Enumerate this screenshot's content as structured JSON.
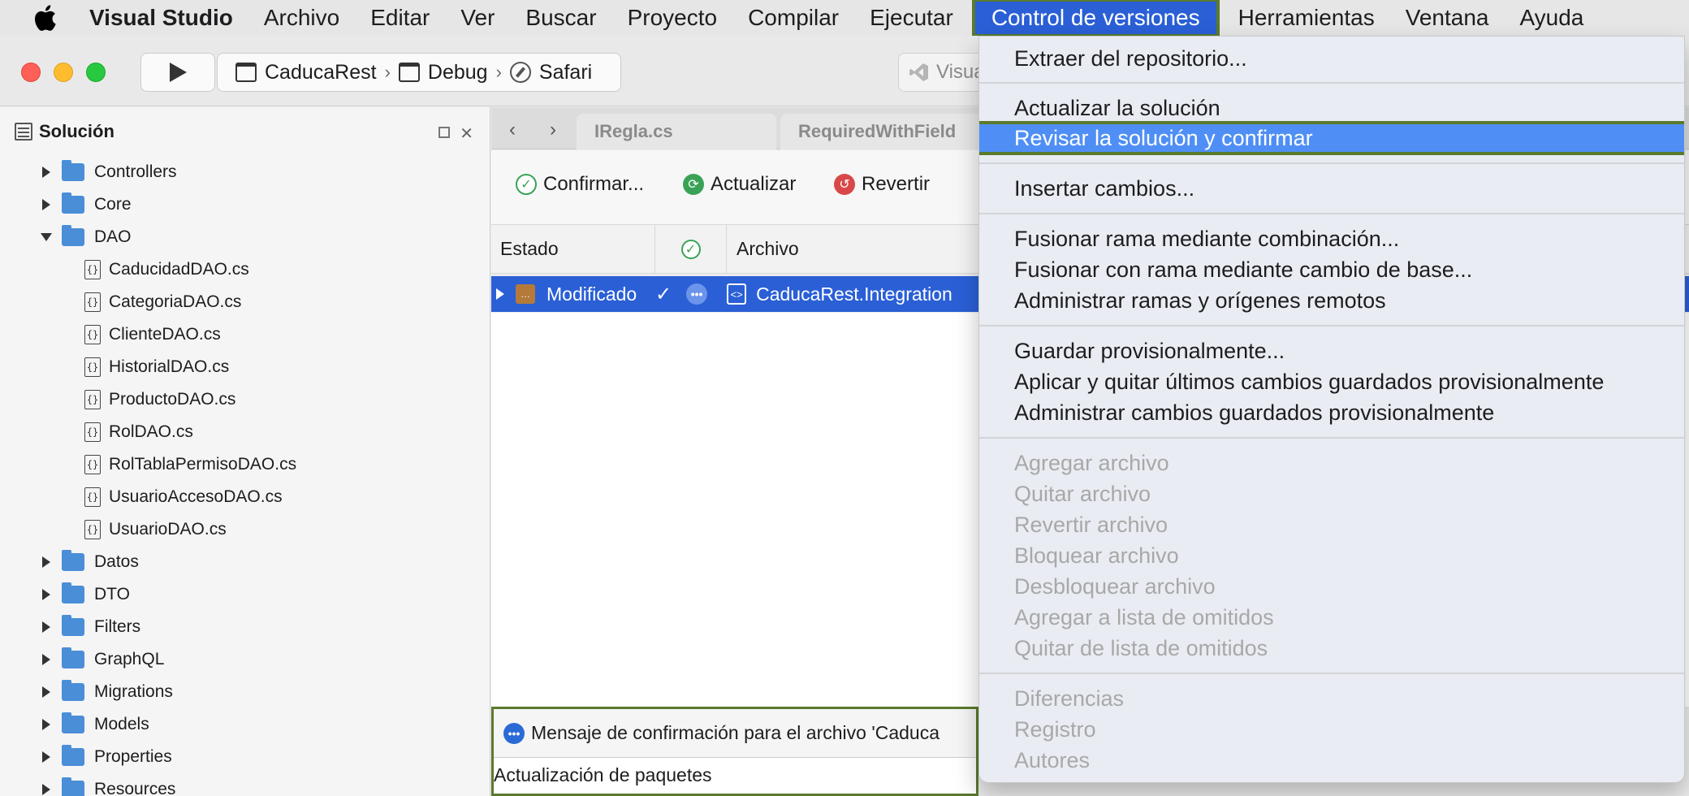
{
  "menubar": {
    "app_name": "Visual Studio",
    "menus": [
      "Archivo",
      "Editar",
      "Ver",
      "Buscar",
      "Proyecto",
      "Compilar",
      "Ejecutar",
      "Control de versiones",
      "Herramientas",
      "Ventana",
      "Ayuda"
    ],
    "active_menu": "Control de versiones"
  },
  "toolbar": {
    "project": "CaducaRest",
    "configuration": "Debug",
    "target": "Safari",
    "vs_badge": "Visua"
  },
  "solution_pad": {
    "title": "Solución",
    "items": [
      {
        "label": "Controllers",
        "type": "folder",
        "expanded": false
      },
      {
        "label": "Core",
        "type": "folder",
        "expanded": false
      },
      {
        "label": "DAO",
        "type": "folder",
        "expanded": true
      },
      {
        "label": "CaducidadDAO.cs",
        "type": "file"
      },
      {
        "label": "CategoriaDAO.cs",
        "type": "file"
      },
      {
        "label": "ClienteDAO.cs",
        "type": "file"
      },
      {
        "label": "HistorialDAO.cs",
        "type": "file"
      },
      {
        "label": "ProductoDAO.cs",
        "type": "file"
      },
      {
        "label": "RolDAO.cs",
        "type": "file"
      },
      {
        "label": "RolTablaPermisoDAO.cs",
        "type": "file"
      },
      {
        "label": "UsuarioAccesoDAO.cs",
        "type": "file"
      },
      {
        "label": "UsuarioDAO.cs",
        "type": "file"
      },
      {
        "label": "Datos",
        "type": "folder",
        "expanded": false
      },
      {
        "label": "DTO",
        "type": "folder",
        "expanded": false
      },
      {
        "label": "Filters",
        "type": "folder",
        "expanded": false
      },
      {
        "label": "GraphQL",
        "type": "folder",
        "expanded": false
      },
      {
        "label": "Migrations",
        "type": "folder",
        "expanded": false
      },
      {
        "label": "Models",
        "type": "folder",
        "expanded": false
      },
      {
        "label": "Properties",
        "type": "folder",
        "expanded": false
      },
      {
        "label": "Resources",
        "type": "folder",
        "expanded": false
      }
    ]
  },
  "tabs": [
    "IRegla.cs",
    "RequiredWithField"
  ],
  "vc_toolbar": {
    "commit": "Confirmar...",
    "update": "Actualizar",
    "revert": "Revertir"
  },
  "vc_table": {
    "headers": {
      "status": "Estado",
      "file": "Archivo"
    },
    "row": {
      "status": "Modificado",
      "check": "✓",
      "file": "CaducaRest.Integration"
    }
  },
  "commit_message": {
    "label": "Mensaje de confirmación para el archivo 'Caduca",
    "text": "Actualización de paquetes"
  },
  "dropdown": {
    "items": [
      {
        "label": "Extraer del repositorio...",
        "disabled": false
      },
      {
        "label": "Actualizar la solución",
        "disabled": false
      },
      {
        "label": "Revisar la solución y confirmar",
        "disabled": false,
        "selected": true
      },
      {
        "label": "Insertar cambios...",
        "disabled": false
      },
      {
        "label": "Fusionar rama mediante combinación...",
        "disabled": false
      },
      {
        "label": "Fusionar con rama mediante cambio de base...",
        "disabled": false
      },
      {
        "label": "Administrar ramas y orígenes remotos",
        "disabled": false
      },
      {
        "label": "Guardar provisionalmente...",
        "disabled": false
      },
      {
        "label": "Aplicar y quitar últimos cambios guardados provisionalmente",
        "disabled": false
      },
      {
        "label": "Administrar cambios guardados provisionalmente",
        "disabled": false
      },
      {
        "label": "Agregar archivo",
        "disabled": true
      },
      {
        "label": "Quitar archivo",
        "disabled": true
      },
      {
        "label": "Revertir archivo",
        "disabled": true
      },
      {
        "label": "Bloquear archivo",
        "disabled": true
      },
      {
        "label": "Desbloquear archivo",
        "disabled": true
      },
      {
        "label": "Agregar a lista de omitidos",
        "disabled": true
      },
      {
        "label": "Quitar de lista de omitidos",
        "disabled": true
      },
      {
        "label": "Diferencias",
        "disabled": true
      },
      {
        "label": "Registro",
        "disabled": true
      },
      {
        "label": "Autores",
        "disabled": true
      }
    ]
  },
  "colors": {
    "accent": "#2a5fd6",
    "highlight": "#4f8ff5",
    "annotation_outline": "#5a7a2e"
  }
}
